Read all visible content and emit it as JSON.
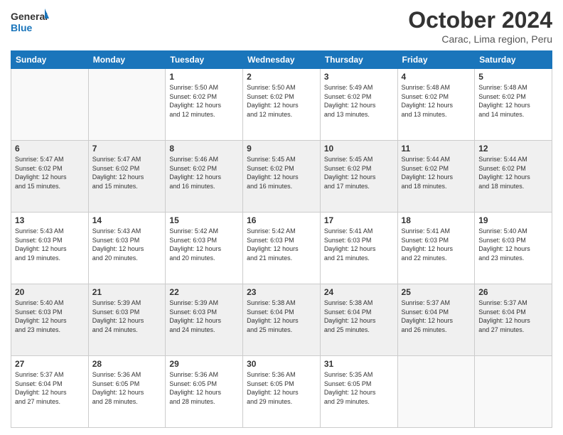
{
  "logo": {
    "line1": "General",
    "line2": "Blue"
  },
  "title": "October 2024",
  "location": "Carac, Lima region, Peru",
  "headers": [
    "Sunday",
    "Monday",
    "Tuesday",
    "Wednesday",
    "Thursday",
    "Friday",
    "Saturday"
  ],
  "weeks": [
    [
      {
        "day": "",
        "info": ""
      },
      {
        "day": "",
        "info": ""
      },
      {
        "day": "1",
        "info": "Sunrise: 5:50 AM\nSunset: 6:02 PM\nDaylight: 12 hours\nand 12 minutes."
      },
      {
        "day": "2",
        "info": "Sunrise: 5:50 AM\nSunset: 6:02 PM\nDaylight: 12 hours\nand 12 minutes."
      },
      {
        "day": "3",
        "info": "Sunrise: 5:49 AM\nSunset: 6:02 PM\nDaylight: 12 hours\nand 13 minutes."
      },
      {
        "day": "4",
        "info": "Sunrise: 5:48 AM\nSunset: 6:02 PM\nDaylight: 12 hours\nand 13 minutes."
      },
      {
        "day": "5",
        "info": "Sunrise: 5:48 AM\nSunset: 6:02 PM\nDaylight: 12 hours\nand 14 minutes."
      }
    ],
    [
      {
        "day": "6",
        "info": "Sunrise: 5:47 AM\nSunset: 6:02 PM\nDaylight: 12 hours\nand 15 minutes."
      },
      {
        "day": "7",
        "info": "Sunrise: 5:47 AM\nSunset: 6:02 PM\nDaylight: 12 hours\nand 15 minutes."
      },
      {
        "day": "8",
        "info": "Sunrise: 5:46 AM\nSunset: 6:02 PM\nDaylight: 12 hours\nand 16 minutes."
      },
      {
        "day": "9",
        "info": "Sunrise: 5:45 AM\nSunset: 6:02 PM\nDaylight: 12 hours\nand 16 minutes."
      },
      {
        "day": "10",
        "info": "Sunrise: 5:45 AM\nSunset: 6:02 PM\nDaylight: 12 hours\nand 17 minutes."
      },
      {
        "day": "11",
        "info": "Sunrise: 5:44 AM\nSunset: 6:02 PM\nDaylight: 12 hours\nand 18 minutes."
      },
      {
        "day": "12",
        "info": "Sunrise: 5:44 AM\nSunset: 6:02 PM\nDaylight: 12 hours\nand 18 minutes."
      }
    ],
    [
      {
        "day": "13",
        "info": "Sunrise: 5:43 AM\nSunset: 6:03 PM\nDaylight: 12 hours\nand 19 minutes."
      },
      {
        "day": "14",
        "info": "Sunrise: 5:43 AM\nSunset: 6:03 PM\nDaylight: 12 hours\nand 20 minutes."
      },
      {
        "day": "15",
        "info": "Sunrise: 5:42 AM\nSunset: 6:03 PM\nDaylight: 12 hours\nand 20 minutes."
      },
      {
        "day": "16",
        "info": "Sunrise: 5:42 AM\nSunset: 6:03 PM\nDaylight: 12 hours\nand 21 minutes."
      },
      {
        "day": "17",
        "info": "Sunrise: 5:41 AM\nSunset: 6:03 PM\nDaylight: 12 hours\nand 21 minutes."
      },
      {
        "day": "18",
        "info": "Sunrise: 5:41 AM\nSunset: 6:03 PM\nDaylight: 12 hours\nand 22 minutes."
      },
      {
        "day": "19",
        "info": "Sunrise: 5:40 AM\nSunset: 6:03 PM\nDaylight: 12 hours\nand 23 minutes."
      }
    ],
    [
      {
        "day": "20",
        "info": "Sunrise: 5:40 AM\nSunset: 6:03 PM\nDaylight: 12 hours\nand 23 minutes."
      },
      {
        "day": "21",
        "info": "Sunrise: 5:39 AM\nSunset: 6:03 PM\nDaylight: 12 hours\nand 24 minutes."
      },
      {
        "day": "22",
        "info": "Sunrise: 5:39 AM\nSunset: 6:03 PM\nDaylight: 12 hours\nand 24 minutes."
      },
      {
        "day": "23",
        "info": "Sunrise: 5:38 AM\nSunset: 6:04 PM\nDaylight: 12 hours\nand 25 minutes."
      },
      {
        "day": "24",
        "info": "Sunrise: 5:38 AM\nSunset: 6:04 PM\nDaylight: 12 hours\nand 25 minutes."
      },
      {
        "day": "25",
        "info": "Sunrise: 5:37 AM\nSunset: 6:04 PM\nDaylight: 12 hours\nand 26 minutes."
      },
      {
        "day": "26",
        "info": "Sunrise: 5:37 AM\nSunset: 6:04 PM\nDaylight: 12 hours\nand 27 minutes."
      }
    ],
    [
      {
        "day": "27",
        "info": "Sunrise: 5:37 AM\nSunset: 6:04 PM\nDaylight: 12 hours\nand 27 minutes."
      },
      {
        "day": "28",
        "info": "Sunrise: 5:36 AM\nSunset: 6:05 PM\nDaylight: 12 hours\nand 28 minutes."
      },
      {
        "day": "29",
        "info": "Sunrise: 5:36 AM\nSunset: 6:05 PM\nDaylight: 12 hours\nand 28 minutes."
      },
      {
        "day": "30",
        "info": "Sunrise: 5:36 AM\nSunset: 6:05 PM\nDaylight: 12 hours\nand 29 minutes."
      },
      {
        "day": "31",
        "info": "Sunrise: 5:35 AM\nSunset: 6:05 PM\nDaylight: 12 hours\nand 29 minutes."
      },
      {
        "day": "",
        "info": ""
      },
      {
        "day": "",
        "info": ""
      }
    ]
  ]
}
